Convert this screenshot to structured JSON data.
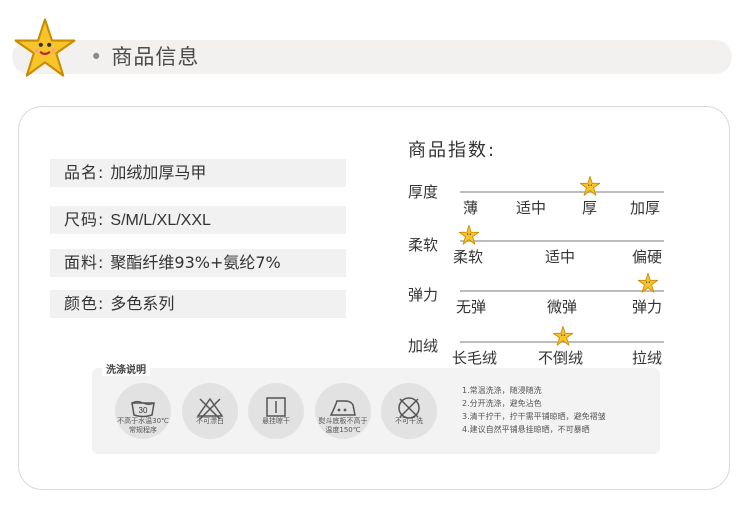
{
  "header": {
    "title": "商品信息",
    "bullet": "•"
  },
  "specs": [
    {
      "label": "品名:",
      "value": "加绒加厚马甲"
    },
    {
      "label": "尺码:",
      "value": "S/M/L/XL/XXL"
    },
    {
      "label": "面料:",
      "value": "聚酯纤维93%+氨纶7%"
    },
    {
      "label": "颜色:",
      "value": "多色系列"
    }
  ],
  "index": {
    "title": "商品指数:",
    "rows": [
      {
        "name": "厚度",
        "ticks": [
          "薄",
          "适中",
          "厚",
          "加厚"
        ],
        "selected_index": 2
      },
      {
        "name": "柔软",
        "ticks": [
          "柔软",
          "适中",
          "偏硬"
        ],
        "selected_index": 0
      },
      {
        "name": "弹力",
        "ticks": [
          "无弹",
          "微弹",
          "弹力"
        ],
        "selected_index": 2
      },
      {
        "name": "加绒",
        "ticks": [
          "长毛绒",
          "不倒绒",
          "拉绒"
        ],
        "selected_index": 1
      }
    ]
  },
  "washing": {
    "title": "洗涤说明",
    "icons": [
      {
        "label": "不高于水温30℃\n常规程序",
        "icon": "wash-30-icon",
        "mark": "30"
      },
      {
        "label": "不可漂白",
        "icon": "no-bleach-icon"
      },
      {
        "label": "悬挂晾干",
        "icon": "hang-dry-icon"
      },
      {
        "label": "熨斗底板不高于\n温度150℃",
        "icon": "iron-150-icon"
      },
      {
        "label": "不可干洗",
        "icon": "no-dry-clean-icon"
      }
    ],
    "notes": [
      "1.常温洗涤，随浸随洗",
      "2.分开洗涤，避免沾色",
      "3.清干拧干，拧干需平铺晾晒，避免褶皱",
      "4.建议自然平铺悬挂晾晒，不可暴晒"
    ]
  },
  "colors": {
    "header_bar": "#f2f1ef",
    "star": "#f7c52b",
    "star_outline": "#c98c00",
    "line": "#bdbdbd"
  }
}
